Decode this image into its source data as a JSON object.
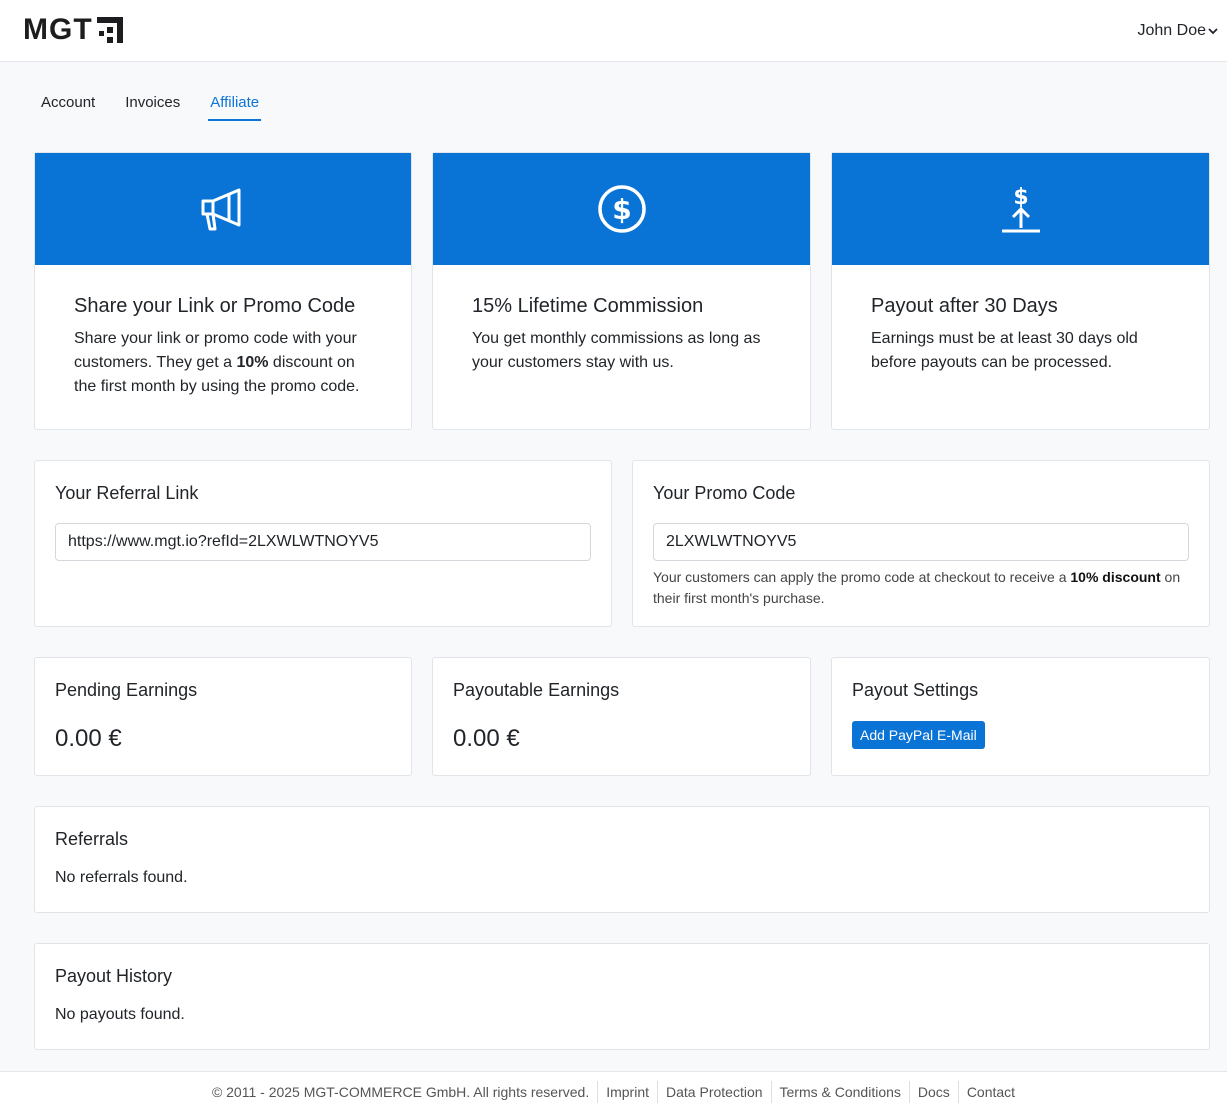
{
  "header": {
    "logo_text": "MGT",
    "logo_icon": "mgt-logo-mark",
    "user_name": "John Doe",
    "user_menu_icon": "chevron-down-icon"
  },
  "tabs": [
    {
      "label": "Account",
      "active": false
    },
    {
      "label": "Invoices",
      "active": false
    },
    {
      "label": "Affiliate",
      "active": true
    }
  ],
  "features": [
    {
      "icon": "megaphone-icon",
      "title": "Share your Link or Promo Code",
      "text_before": "Share your link or promo code with your customers. They get a ",
      "text_bold": "10%",
      "text_after": " discount on the first month by using the promo code."
    },
    {
      "icon": "dollar-circle-icon",
      "title": "15% Lifetime Commission",
      "text": "You get monthly commissions as long as your customers stay with us."
    },
    {
      "icon": "payout-upload-icon",
      "title": "Payout after 30 Days",
      "text": "Earnings must be at least 30 days old before payouts can be processed."
    }
  ],
  "referral": {
    "title": "Your Referral Link",
    "value": "https://www.mgt.io?refId=2LXWLWTNOYV5"
  },
  "promo": {
    "title": "Your Promo Code",
    "value": "2LXWLWTNOYV5",
    "hint_before": "Your customers can apply the promo code at checkout to receive a ",
    "hint_bold": "10% discount",
    "hint_after": " on their first month's purchase."
  },
  "pending": {
    "title": "Pending Earnings",
    "amount": "0.00 €"
  },
  "payoutable": {
    "title": "Payoutable Earnings",
    "amount": "0.00 €"
  },
  "payout_settings": {
    "title": "Payout Settings",
    "button": "Add PayPal E-Mail"
  },
  "referrals": {
    "title": "Referrals",
    "empty": "No referrals found."
  },
  "payout_history": {
    "title": "Payout History",
    "empty": "No payouts found."
  },
  "footer": {
    "copyright": "© 2011 - 2025 MGT-COMMERCE GmbH. All rights reserved.",
    "links": [
      "Imprint",
      "Data Protection",
      "Terms & Conditions",
      "Docs",
      "Contact"
    ]
  },
  "colors": {
    "accent": "#0a74d6",
    "background": "#f8f9fb"
  }
}
